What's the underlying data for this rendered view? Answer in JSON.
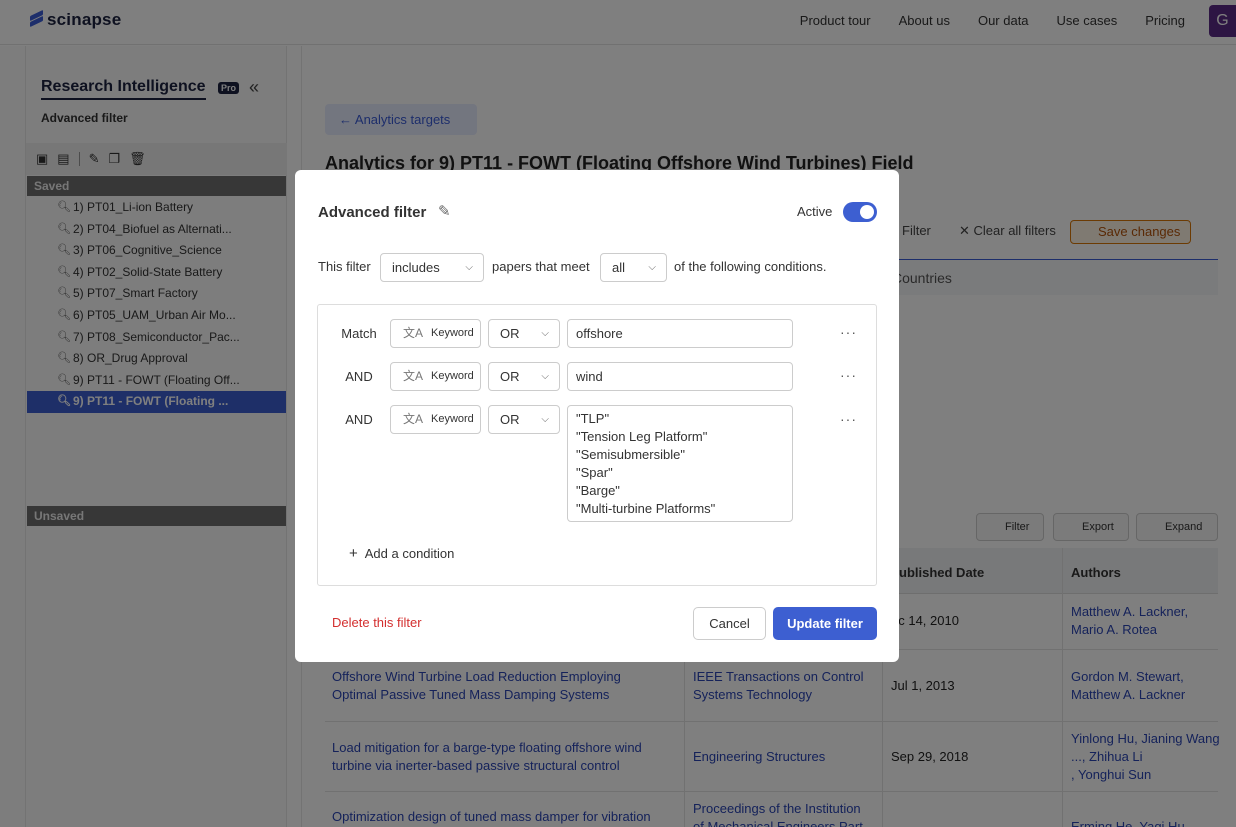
{
  "nav": {
    "brand": "scinapse",
    "links": [
      "Product tour",
      "About us",
      "Our data",
      "Use cases",
      "Pricing"
    ],
    "avatar_letter": "G"
  },
  "sidebar": {
    "title": "Research Intelligence",
    "badge": "Pro",
    "subtitle": "Advanced filter",
    "saved_label": "Saved",
    "unsaved_label": "Unsaved",
    "items": [
      "1) PT01_Li-ion Battery",
      "2) PT04_Biofuel as Alternati...",
      "3) PT06_Cognitive_Science",
      "4) PT02_Solid-State Battery",
      "5) PT07_Smart Factory",
      "6) PT05_UAM_Urban Air Mo...",
      "7) PT08_Semiconductor_Pac...",
      "8) OR_Drug Approval",
      "9) PT11 - FOWT (Floating Off...",
      "9) PT11 - FOWT (Floating ..."
    ],
    "active_index": 9
  },
  "main": {
    "back_label": "Analytics targets",
    "title": "Analytics for 9) PT11 - FOWT (Floating Offshore Wind Turbines)  Field",
    "filter_label": "Filter",
    "clear_label": "Clear all filters",
    "save_label": "Save changes",
    "tab_countries": "Countries",
    "btn_filter": "Filter",
    "btn_export": "Export",
    "btn_expand": "Expand",
    "col_published": "ublished Date",
    "col_authors": "Authors",
    "rows": [
      {
        "title": "",
        "source": "",
        "date": "ec 14, 2010",
        "authors": [
          "Matthew A. Lackner,",
          "Mario A. Rotea"
        ]
      },
      {
        "title": [
          "Offshore Wind Turbine Load Reduction Employing",
          "Optimal Passive Tuned Mass Damping Systems"
        ],
        "source": [
          "IEEE Transactions on Control",
          "Systems Technology"
        ],
        "date": "Jul 1, 2013",
        "authors": [
          "Gordon M. Stewart,",
          "Matthew A. Lackner"
        ]
      },
      {
        "title": [
          "Load mitigation for a barge-type floating offshore wind",
          "turbine via inerter-based passive structural control"
        ],
        "source": [
          "Engineering Structures"
        ],
        "date": "Sep 29, 2018",
        "authors": [
          "Yinlong Hu, Jianing Wang",
          "..., Zhihua Li",
          ", Yonghui Sun"
        ]
      },
      {
        "title": [
          "Optimization design of tuned mass damper for vibration"
        ],
        "source": [
          "Proceedings of the Institution",
          "of Mechanical Engineers Part"
        ],
        "date": "",
        "authors": [
          "Erming He, Yaqi Hu"
        ]
      }
    ]
  },
  "modal": {
    "title": "Advanced filter",
    "active_label": "Active",
    "active": true,
    "sentence_prefix": "This filter",
    "includes_value": "includes",
    "sentence_mid": "papers that meet",
    "meet_value": "all",
    "sentence_suffix": "of the following conditions.",
    "conditions": [
      {
        "label": "Match",
        "field": "Keyword",
        "operator": "OR",
        "value": "offshore"
      },
      {
        "label": "AND",
        "field": "Keyword",
        "operator": "OR",
        "value": "wind"
      },
      {
        "label": "AND",
        "field": "Keyword",
        "operator": "OR",
        "value_lines": [
          "\"TLP\"",
          "\"Tension Leg Platform\"",
          "\"Semisubmersible\"",
          "\"Spar\"",
          "\"Barge\"",
          "\"Multi-turbine Platforms\""
        ]
      }
    ],
    "add_condition": "Add a condition",
    "delete_label": "Delete this filter",
    "cancel_label": "Cancel",
    "update_label": "Update filter"
  },
  "colors": {
    "accent": "#3d5fd1",
    "danger": "#d32f2f",
    "warning": "#d97706"
  }
}
